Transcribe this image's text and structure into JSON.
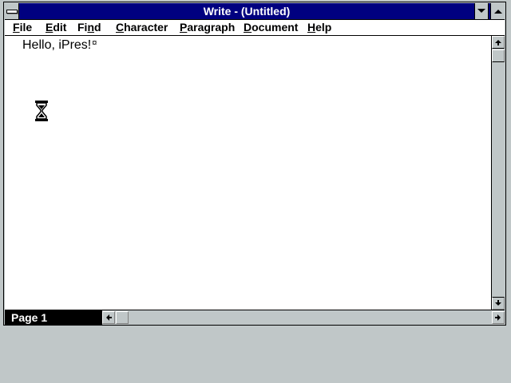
{
  "window": {
    "title": "Write - (Untitled)"
  },
  "menubar": {
    "items": [
      {
        "label": "File",
        "underline": "F",
        "rest": "ile"
      },
      {
        "label": "Edit",
        "underline": "E",
        "rest": "dit"
      },
      {
        "label": "Find",
        "prefix": "Fi",
        "underline": "n",
        "rest": "d"
      },
      {
        "label": "Character",
        "underline": "C",
        "rest": "haracter"
      },
      {
        "label": "Paragraph",
        "underline": "P",
        "rest": "aragraph"
      },
      {
        "label": "Document",
        "underline": "D",
        "rest": "ocument"
      },
      {
        "label": "Help",
        "underline": "H",
        "rest": "elp"
      }
    ]
  },
  "document": {
    "text": "Hello, iPres!",
    "end_mark": "¤"
  },
  "status": {
    "page_label": "Page 1"
  },
  "icons": {
    "system_menu": "system-menu-icon",
    "minimize": "minimize-arrow-icon",
    "maximize": "maximize-arrow-icon",
    "cursor": "hourglass-icon",
    "scroll_up": "arrow-up-icon",
    "scroll_down": "arrow-down-icon",
    "scroll_left": "arrow-left-icon",
    "scroll_right": "arrow-right-icon"
  },
  "colors": {
    "titlebar": "#000080",
    "face": "#c0c7c8",
    "document": "#ffffff"
  }
}
